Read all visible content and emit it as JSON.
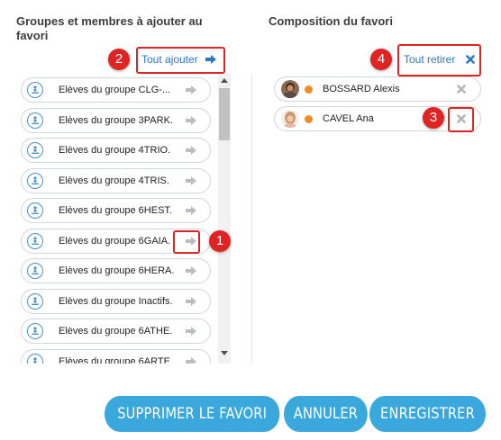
{
  "left_panel": {
    "title": "Groupes et membres à ajouter au favori",
    "add_all_label": "Tout ajouter",
    "groups": [
      {
        "label": "Elèves du groupe CLG-..."
      },
      {
        "label": "Elèves du groupe 3PARK."
      },
      {
        "label": "Elèves du groupe 4TRIO."
      },
      {
        "label": "Elèves du groupe 4TRIS."
      },
      {
        "label": "Elèves du groupe 6HEST."
      },
      {
        "label": "Elèves du groupe 6GAIA."
      },
      {
        "label": "Elèves du groupe 6HERA."
      },
      {
        "label": "Elèves du groupe Inactifs."
      },
      {
        "label": "Elèves du groupe 6ATHE."
      },
      {
        "label": "Elèves du groupe 6ARTE"
      }
    ]
  },
  "right_panel": {
    "title": "Composition du favori",
    "remove_all_label": "Tout retirer",
    "members": [
      {
        "name": "BOSSARD Alexis",
        "status_color": "#f28c28"
      },
      {
        "name": "CAVEL Ana",
        "status_color": "#f28c28"
      }
    ]
  },
  "annotations": [
    "1",
    "2",
    "3",
    "4"
  ],
  "buttons": {
    "delete": "SUPPRIMER LE FAVORI",
    "cancel": "ANNULER",
    "save": "ENREGISTRER"
  },
  "colors": {
    "accent": "#3aa8dc",
    "link": "#2c79c1",
    "annotation_red": "#e02424",
    "status_orange": "#f28c28"
  }
}
